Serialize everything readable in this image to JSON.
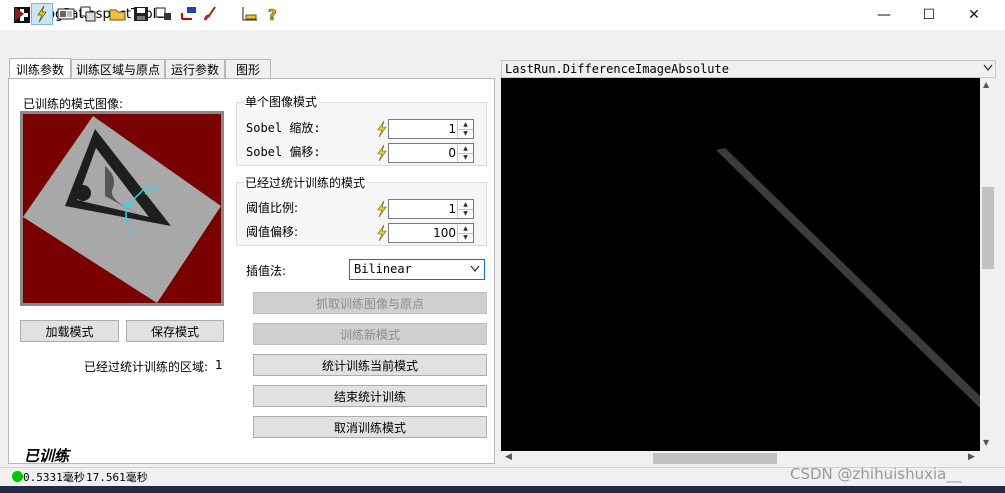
{
  "window": {
    "title": "CogPatInspectTool1",
    "minimize_glyph": "—",
    "maximize_glyph": "☐",
    "close_glyph": "✕"
  },
  "toolbar": {
    "icons": [
      "run-icon",
      "electric-icon",
      "display-icon",
      "copy-icon",
      "open-folder-icon",
      "save-icon",
      "edit-icon",
      "reset-icon",
      "brush-icon",
      "ruler-icon",
      "help-icon"
    ]
  },
  "tabs": [
    {
      "label": "训练参数",
      "active": true
    },
    {
      "label": "训练区域与原点",
      "active": false
    },
    {
      "label": "运行参数",
      "active": false
    },
    {
      "label": "图形",
      "active": false
    }
  ],
  "left": {
    "pattern_label": "已训练的模式图像:",
    "load_button": "加载模式",
    "save_button": "保存模式",
    "region_label": "已经过统计训练的区域:",
    "region_count": "1",
    "status_text": "已训练"
  },
  "single_image": {
    "title": "单个图像模式",
    "sobel_scale_label": "Sobel 缩放:",
    "sobel_scale_value": "1",
    "sobel_offset_label": "Sobel 偏移:",
    "sobel_offset_value": "0"
  },
  "stat_trained": {
    "title": "已经过统计训练的模式",
    "threshold_ratio_label": "阈值比例:",
    "threshold_ratio_value": "1",
    "threshold_offset_label": "阈值偏移:",
    "threshold_offset_value": "100"
  },
  "interpolation": {
    "label": "插值法:",
    "value": "Bilinear"
  },
  "actions": {
    "grab": "抓取训练图像与原点",
    "train_new": "训练新模式",
    "stat_train": "统计训练当前模式",
    "end_train": "结束统计训练",
    "cancel_train": "取消训练模式"
  },
  "display": {
    "title": "LastRun.DifferenceImageAbsolute"
  },
  "status_bar": {
    "time1": "0.5331毫秒",
    "time2": "17.561毫秒",
    "indicator_color": "#00c800"
  },
  "watermark": "CSDN @zhihuishuxia__"
}
